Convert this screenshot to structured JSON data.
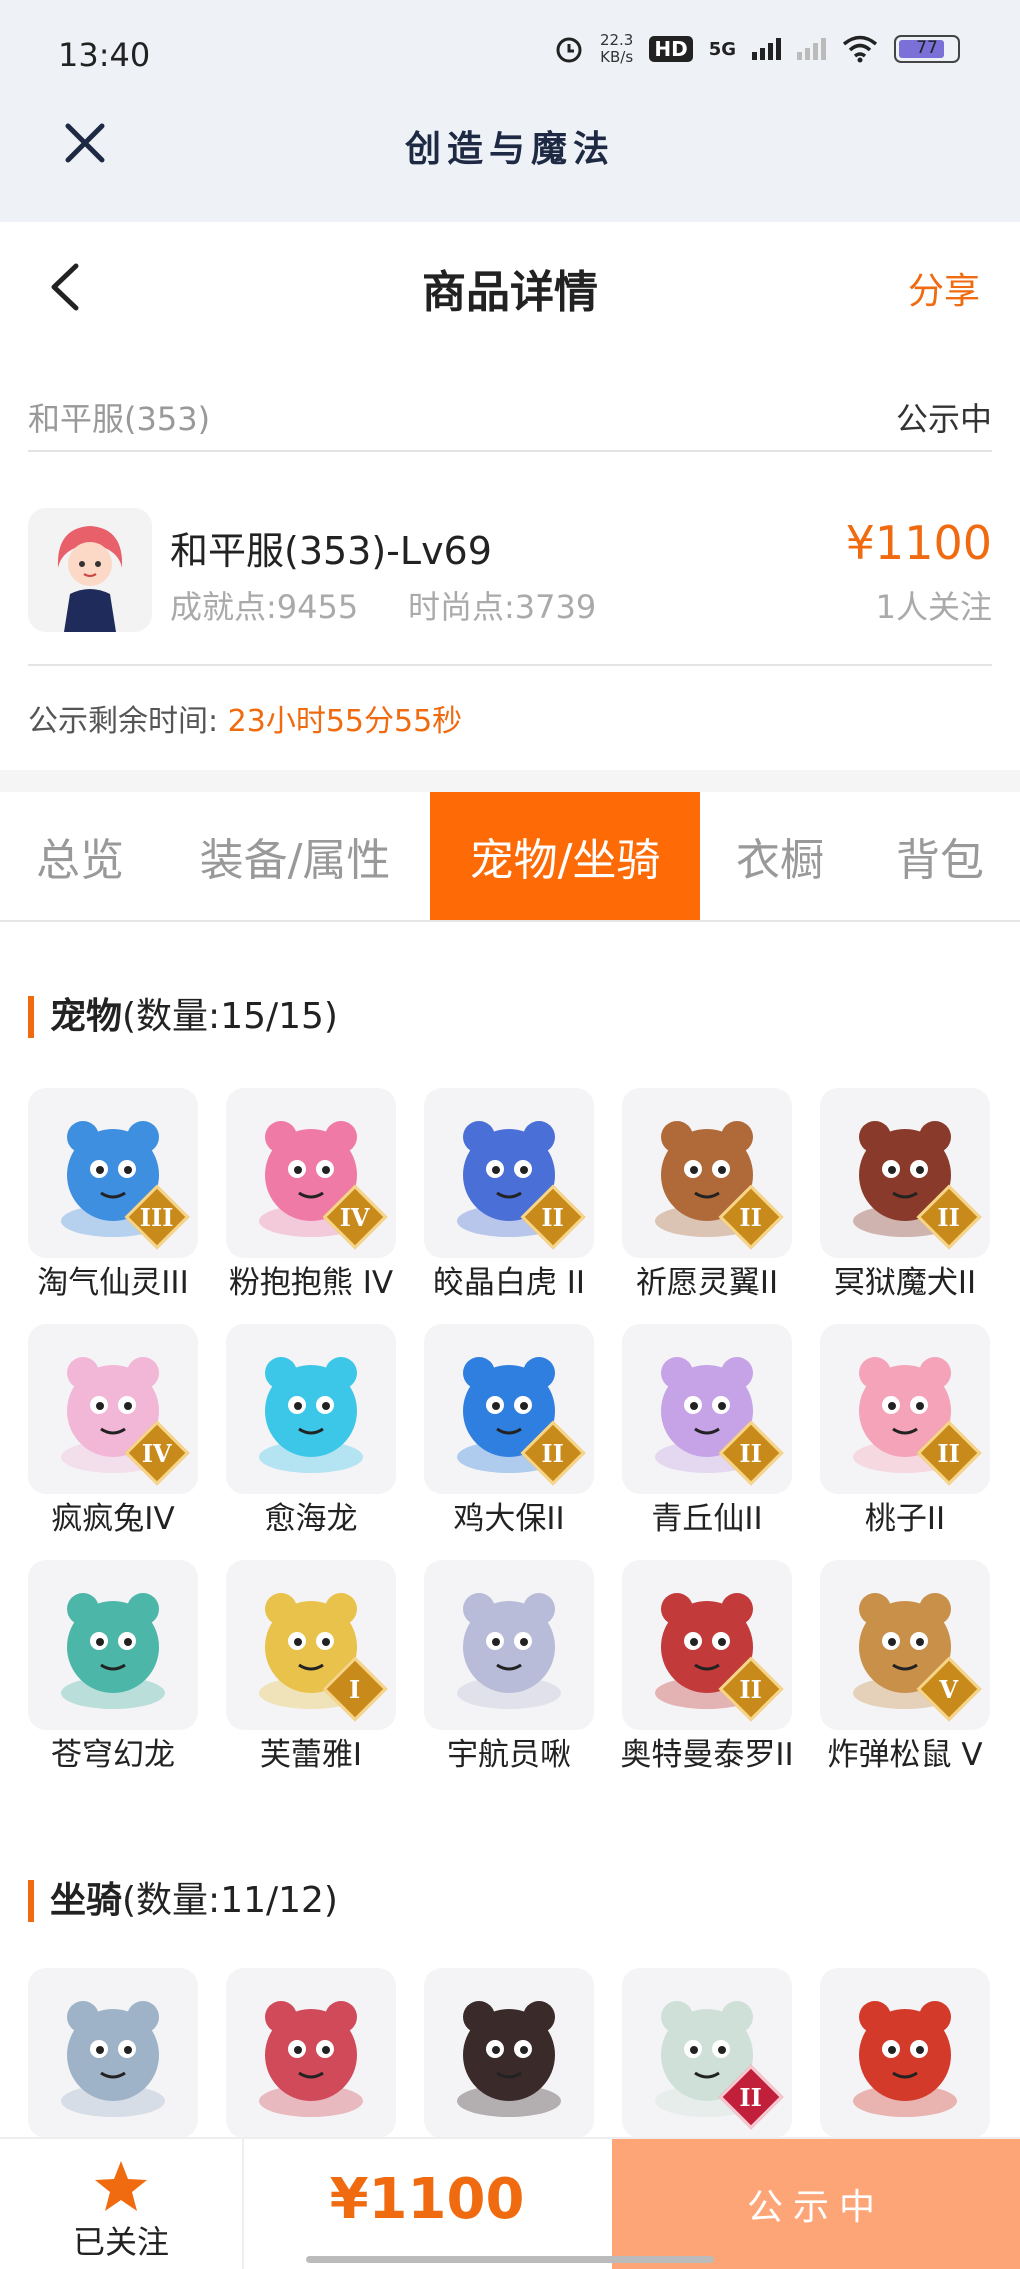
{
  "status_bar": {
    "time": "13:40",
    "speed_value": "22.3",
    "speed_unit": "KB/s",
    "hd": "HD",
    "network": "5G",
    "battery": "77"
  },
  "app_header": {
    "title": "创造与魔法"
  },
  "page_header": {
    "title": "商品详情",
    "share": "分享"
  },
  "server_row": {
    "server": "和平服(353)",
    "state": "公示中"
  },
  "character": {
    "name": "和平服(353)-Lv69",
    "achievement": "成就点:9455",
    "fashion": "时尚点:3739",
    "price": "¥1100",
    "followers": "1人关注"
  },
  "remaining": {
    "label": "公示剩余时间:",
    "value": "23小时55分55秒"
  },
  "tabs": [
    {
      "label": "总览",
      "active": false
    },
    {
      "label": "装备/属性",
      "active": false
    },
    {
      "label": "宠物/坐骑",
      "active": true
    },
    {
      "label": "衣橱",
      "active": false
    },
    {
      "label": "背包",
      "active": false
    }
  ],
  "pets": {
    "title": "宠物",
    "count": "(数量:15/15)",
    "items": [
      {
        "name": "淘气仙灵III",
        "tier": "III",
        "color": "#3f8fe0"
      },
      {
        "name": "粉抱抱熊 IV",
        "tier": "IV",
        "color": "#f07aa6"
      },
      {
        "name": "皎晶白虎 II",
        "tier": "II",
        "color": "#4a6fd6"
      },
      {
        "name": "祈愿灵翼II",
        "tier": "II",
        "color": "#b06a3a"
      },
      {
        "name": "冥狱魔犬II",
        "tier": "II",
        "color": "#8a3a2a"
      },
      {
        "name": "疯疯兔IV",
        "tier": "IV",
        "color": "#f2b7d6"
      },
      {
        "name": "愈海龙",
        "tier": "",
        "color": "#3cc7e8"
      },
      {
        "name": "鸡大保II",
        "tier": "II",
        "color": "#2f7fe0"
      },
      {
        "name": "青丘仙II",
        "tier": "II",
        "color": "#c6a2e6"
      },
      {
        "name": "桃子II",
        "tier": "II",
        "color": "#f5a3b8"
      },
      {
        "name": "苍穹幻龙",
        "tier": "",
        "color": "#4cb6a8"
      },
      {
        "name": "芙蕾雅I",
        "tier": "I",
        "color": "#e8c24a"
      },
      {
        "name": "宇航员啾",
        "tier": "",
        "color": "#b9bcd8"
      },
      {
        "name": "奥特曼泰罗II",
        "tier": "II",
        "color": "#c23a3a"
      },
      {
        "name": "炸弹松鼠 V",
        "tier": "V",
        "color": "#c9904a"
      }
    ]
  },
  "mounts": {
    "title": "坐骑",
    "count": "(数量:11/12)",
    "items": [
      {
        "tier": "",
        "color": "#9fb3c8"
      },
      {
        "tier": "",
        "color": "#d04a5a"
      },
      {
        "tier": "",
        "color": "#3a2a2a"
      },
      {
        "tier": "II",
        "color": "#cfe0d8"
      },
      {
        "tier": "",
        "color": "#d33a2a"
      }
    ]
  },
  "bottom_bar": {
    "follow_label": "已关注",
    "price": "¥1100",
    "state": "公示中"
  }
}
